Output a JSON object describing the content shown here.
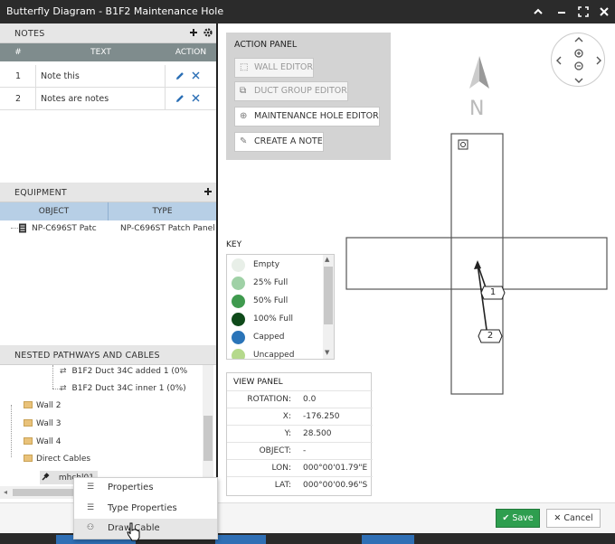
{
  "window": {
    "title": "Butterfly Diagram - B1F2 Maintenance Hole",
    "controls": [
      "chevron-up",
      "minimize",
      "maximize",
      "close"
    ]
  },
  "notes": {
    "header": "NOTES",
    "columns": [
      "#",
      "TEXT",
      "ACTION"
    ],
    "rows": [
      {
        "num": "1",
        "text": "Note this"
      },
      {
        "num": "2",
        "text": "Notes are notes"
      }
    ]
  },
  "equipment": {
    "header": "EQUIPMENT",
    "columns": [
      "OBJECT",
      "TYPE"
    ],
    "rows": [
      {
        "object": "NP-C696ST Patc",
        "type": "NP-C696ST Patch Panel"
      }
    ]
  },
  "pathways": {
    "header": "NESTED PATHWAYS AND CABLES",
    "items": [
      {
        "label": "B1F2 Duct 34C added 1 (0%",
        "kind": "duct"
      },
      {
        "label": "B1F2 Duct 34C inner 1 (0%)",
        "kind": "duct"
      },
      {
        "label": "Wall 2",
        "kind": "folder"
      },
      {
        "label": "Wall 3",
        "kind": "folder"
      },
      {
        "label": "Wall 4",
        "kind": "folder"
      },
      {
        "label": "Direct Cables",
        "kind": "folder"
      },
      {
        "label": "mhchl01",
        "kind": "cable"
      }
    ]
  },
  "action_panel": {
    "title": "ACTION PANEL",
    "buttons": [
      {
        "label": "WALL EDITOR",
        "enabled": false
      },
      {
        "label": "DUCT GROUP EDITOR",
        "enabled": false
      },
      {
        "label": "MAINTENANCE HOLE EDITOR",
        "enabled": true
      },
      {
        "label": "CREATE A NOTE",
        "enabled": true
      }
    ]
  },
  "key": {
    "title": "KEY",
    "items": [
      {
        "label": "Empty",
        "color": "#e8efe8"
      },
      {
        "label": "25% Full",
        "color": "#9fd1a6"
      },
      {
        "label": "50% Full",
        "color": "#3f9a4e"
      },
      {
        "label": "100% Full",
        "color": "#0f4a1a"
      },
      {
        "label": "Capped",
        "color": "#2a74b8"
      },
      {
        "label": "Uncapped",
        "color": "#b5d98c"
      }
    ]
  },
  "view_panel": {
    "title": "VIEW PANEL",
    "rows": [
      {
        "key": "ROTATION:",
        "value": "0.0"
      },
      {
        "key": "X:",
        "value": "-176.250"
      },
      {
        "key": "Y:",
        "value": "28.500"
      },
      {
        "key": "OBJECT:",
        "value": "-"
      },
      {
        "key": "LON:",
        "value": "000°00'01.79\"E"
      },
      {
        "key": "LAT:",
        "value": "000°00'00.96\"S"
      }
    ]
  },
  "compass": {
    "letter": "N"
  },
  "callouts": [
    "1",
    "2"
  ],
  "context_menu": {
    "items": [
      {
        "label": "Properties"
      },
      {
        "label": "Type Properties"
      },
      {
        "label": "Draw Cable"
      }
    ]
  },
  "footer": {
    "save_label": "Save",
    "cancel_label": "Cancel"
  }
}
